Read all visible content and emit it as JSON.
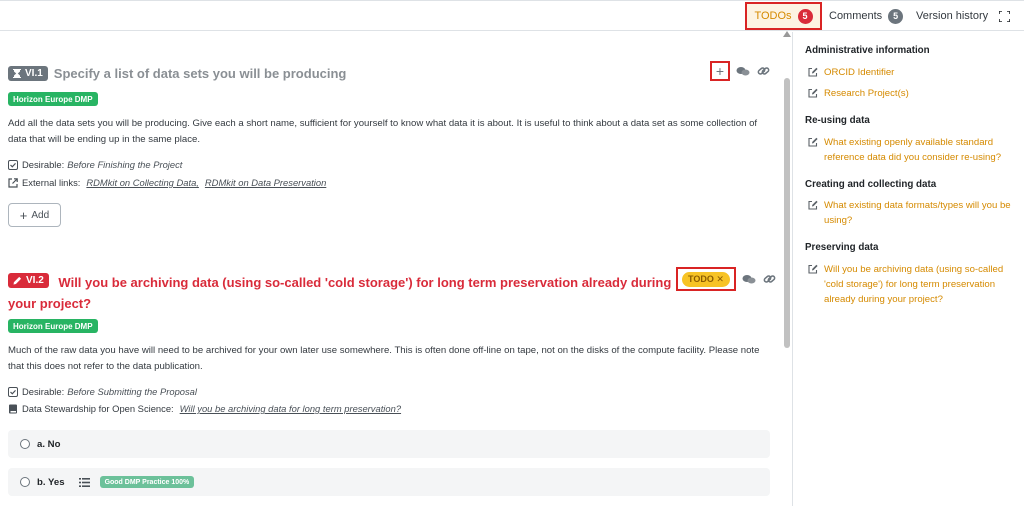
{
  "tabs": {
    "todos_label": "TODOs",
    "todos_count": "5",
    "comments_label": "Comments",
    "comments_count": "5",
    "history_label": "Version history",
    "expand_icon": "expand-icon"
  },
  "questions": [
    {
      "number": "VI.1",
      "title": "Specify a list of data sets you will be producing",
      "tag": "Horizon Europe DMP",
      "description": "Add all the data sets you will be producing. Give each a short name, sufficient for yourself to know what data it is about. It is useful to think about a data set as some collection of data that will be ending up in the same place.",
      "desirable_label": "Desirable:",
      "desirable_value": "Before Finishing the Project",
      "external_label": "External links:",
      "links": [
        "RDMkit on Collecting Data,",
        "RDMkit on Data Preservation"
      ],
      "add_label": "Add"
    },
    {
      "number": "VI.2",
      "title": "Will you be archiving data (using so-called 'cold storage') for long term preservation already during your project?",
      "tag": "Horizon Europe DMP",
      "todo_label": "TODO",
      "description": "Much of the raw data you have will need to be archived for your own later use somewhere. This is often done off-line on tape, not on the disks of the compute facility. Please note that this does not refer to the data publication.",
      "desirable_label": "Desirable:",
      "desirable_value": "Before Submitting the Proposal",
      "book_label": "Data Stewardship for Open Science:",
      "book_link": "Will you be archiving data for long term preservation?",
      "options": [
        {
          "label": "a. No"
        },
        {
          "label": "b. Yes",
          "badge": "Good DMP Practice 100%"
        }
      ]
    }
  ],
  "sidebar": {
    "sections": [
      {
        "title": "Administrative information",
        "items": [
          "ORCID Identifier",
          "Research Project(s)"
        ]
      },
      {
        "title": "Re-using data",
        "items": [
          "What existing openly available standard reference data did you consider re-using?"
        ]
      },
      {
        "title": "Creating and collecting data",
        "items": [
          "What existing data formats/types will you be using?"
        ]
      },
      {
        "title": "Preserving data",
        "items": [
          "Will you be archiving data (using so-called 'cold storage') for long term preservation already during your project?"
        ]
      }
    ]
  },
  "colors": {
    "accent": "#d58a00",
    "danger": "#d92b3a",
    "success": "#28b463",
    "highlight_box": "#d92424"
  }
}
